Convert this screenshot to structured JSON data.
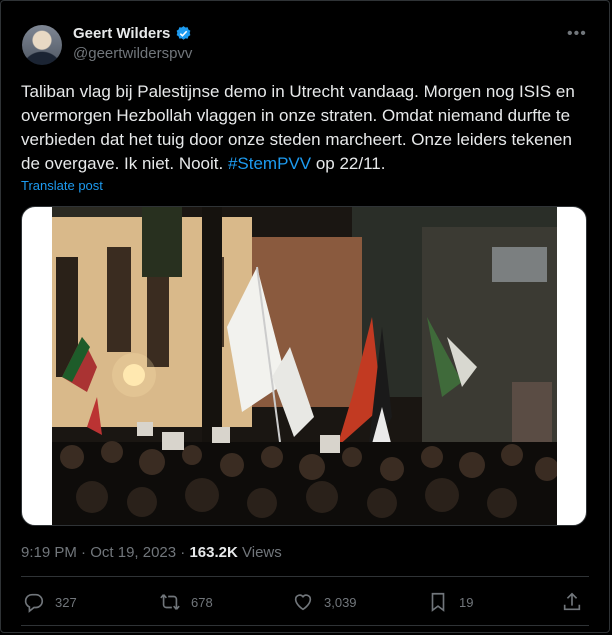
{
  "author": {
    "name": "Geert Wilders",
    "handle": "@geertwilderspvv"
  },
  "tweet": {
    "text": "Taliban vlag bij Palestijnse demo in Utrecht vandaag. Morgen nog ISIS en overmorgen Hezbollah vlaggen in onze straten. Omdat niemand durfte te verbieden dat het tuig door onze steden marcheert. Onze leiders tekenen de overgave. Ik niet. Nooit. ",
    "hashtag": "#StemPVV",
    "suffix": " op 22/11.",
    "translate_label": "Translate post"
  },
  "meta": {
    "time": "9:19 PM",
    "date": "Oct 19, 2023",
    "views_count": "163.2K",
    "views_label": "Views"
  },
  "actions": {
    "replies": "327",
    "reposts": "678",
    "likes": "3,039",
    "bookmarks": "19"
  },
  "colors": {
    "accent": "#1d9bf0",
    "muted": "#71767b",
    "text": "#e7e9ea",
    "border": "#2f3336",
    "background": "#000000"
  },
  "icons": [
    "verified-badge-icon",
    "more-icon",
    "reply-icon",
    "repost-icon",
    "like-icon",
    "bookmark-icon",
    "share-icon"
  ]
}
